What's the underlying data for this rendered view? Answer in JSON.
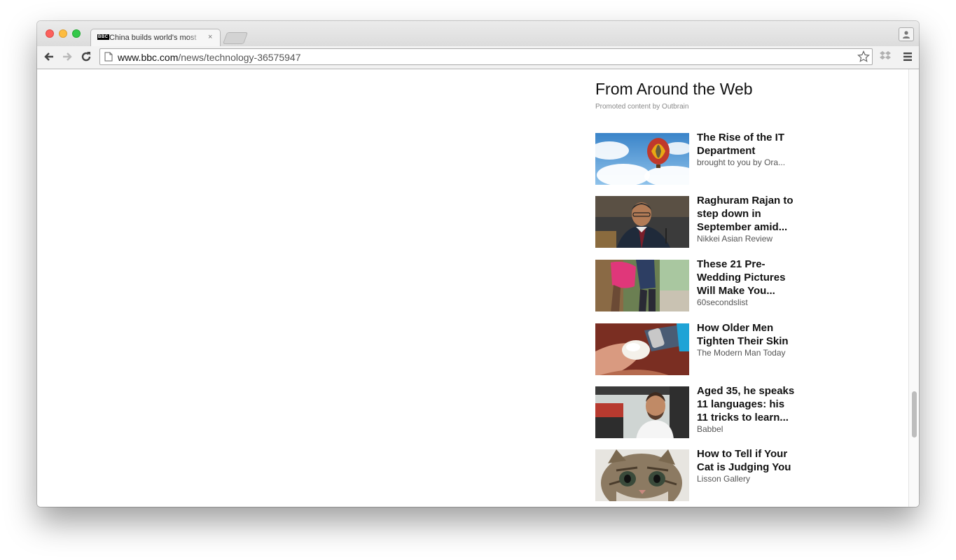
{
  "browser": {
    "tab_title": "China builds world's most",
    "tab_favicon": "BBC",
    "close_glyph": "×",
    "url_host": "www.bbc.com",
    "url_path": "/news/technology-36575947"
  },
  "widget": {
    "title": "From Around the Web",
    "subtitle": "Promoted content by Outbrain",
    "items": [
      {
        "headline": "The Rise of the IT\nDepartment",
        "source": "brought to you by Ora...",
        "image": "hot-air-balloon"
      },
      {
        "headline": "Raghuram Rajan to\nstep down in\nSeptember amid...",
        "source": "Nikkei Asian Review",
        "image": "man-in-suit"
      },
      {
        "headline": "These 21 Pre-\nWedding Pictures\nWill Make You...",
        "source": "60secondslist",
        "image": "couple"
      },
      {
        "headline": "How Older Men\nTighten Their Skin",
        "source": "The Modern Man Today",
        "image": "cream-tube"
      },
      {
        "headline": "Aged 35, he speaks\n11 languages: his\n11 tricks to learn...",
        "source": "Babbel",
        "image": "man-in-tram"
      },
      {
        "headline": "How to Tell if Your\nCat is Judging You",
        "source": "Lisson Gallery",
        "image": "kitten"
      }
    ]
  }
}
